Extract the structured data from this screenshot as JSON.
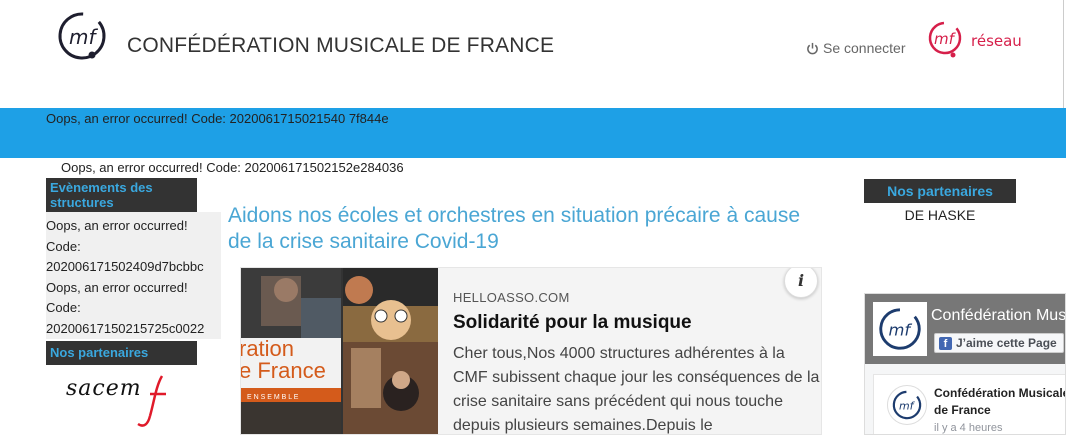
{
  "header": {
    "site_title": "CONFÉDÉRATION MUSICALE DE FRANCE",
    "login_label": "Se connecter",
    "reseau_label": "réseau"
  },
  "errors": {
    "band": "Oops, an error occurred! Code: 2020061715021540 7f844e",
    "top": "Oops, an error occurred! Code: 202006171502152e284036"
  },
  "left": {
    "events_title": "Evènements des structures",
    "events_errors": [
      "Oops, an error occurred! Code: 202006171502409d7bcbbc",
      "Oops, an error occurred! Code: 20200617150215725c0022"
    ],
    "partners_title": "Nos partenaires",
    "sacem_label": "sacem"
  },
  "main": {
    "title": "Aidons nos écoles et orchestres en situation précaire à cause de la crise sanitaire Covid-19",
    "card": {
      "source": "HELLOASSO.COM",
      "title": "Solidarité pour la musique",
      "text": "Cher tous,Nos 4000 structures adhérentes à la CMF subissent chaque jour les conséquences de la crise sanitaire sans précédent qui nous touche depuis plusieurs semaines.Depuis le",
      "info_icon": "i",
      "image_text_1": "ration",
      "image_text_2": "e France",
      "image_text_3": "E N S E M B L E"
    }
  },
  "right": {
    "partners_title": "Nos partenaires",
    "partner_name": "DE HASKE",
    "fb": {
      "page_name": "Confédération Musicale de France",
      "like_label": "J’aime cette Page",
      "post_author": "Confédération Musicale de France",
      "post_time": "il y a 4 heures"
    }
  },
  "colors": {
    "band": "#1ea0e6",
    "title_blue": "#4aa6d4",
    "side_head_bg": "#333333",
    "side_head_text": "#3aa8df",
    "reseau_red": "#d61f4a"
  }
}
